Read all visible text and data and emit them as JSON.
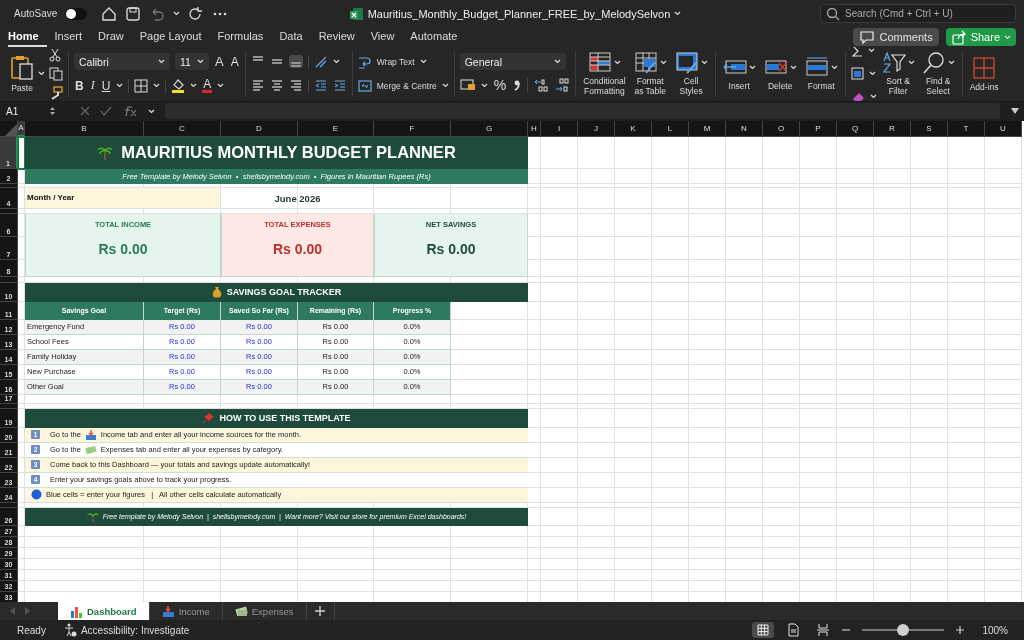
{
  "title_bar": {
    "autosave": {
      "label": "AutoSave",
      "on": false
    },
    "document_title": "Mauritius_Monthly_Budget_Planner_FREE_by_MelodySelvon",
    "search": {
      "placeholder": "Search (Cmd + Ctrl + U)"
    }
  },
  "ribbon_tabs": [
    {
      "label": "Home",
      "selected": true
    },
    {
      "label": "Insert",
      "selected": false
    },
    {
      "label": "Draw",
      "selected": false
    },
    {
      "label": "Page Layout",
      "selected": false
    },
    {
      "label": "Formulas",
      "selected": false
    },
    {
      "label": "Data",
      "selected": false
    },
    {
      "label": "Review",
      "selected": false
    },
    {
      "label": "View",
      "selected": false
    },
    {
      "label": "Automate",
      "selected": false
    }
  ],
  "header_buttons": {
    "comments": "Comments",
    "share": "Share"
  },
  "ribbon": {
    "paste": "Paste",
    "font": "Calibri",
    "font_size": "11",
    "grow_font": "A",
    "shrink_font": "A",
    "style_buttons": [
      "B",
      "I",
      "U"
    ],
    "font_color": "A",
    "wrap_text": "Wrap Text",
    "merge": "Merge & Centre",
    "number_format": "General",
    "percent": "%",
    "large_buttons": [
      {
        "label": [
          "Conditional",
          "Formatting"
        ]
      },
      {
        "label": [
          "Format",
          "as Table"
        ]
      },
      {
        "label": [
          "Cell",
          "Styles"
        ]
      },
      {
        "label": [
          "Insert"
        ]
      },
      {
        "label": [
          "Delete"
        ]
      },
      {
        "label": [
          "Format"
        ]
      }
    ],
    "editing_buttons": [
      {
        "label": [
          "Sort &",
          "Filter"
        ]
      },
      {
        "label": [
          "Find &",
          "Select"
        ]
      }
    ],
    "addins": "Add-ins"
  },
  "formula_bar": {
    "name_box": "A1"
  },
  "columns": [
    {
      "label": "A",
      "selected": true
    },
    {
      "label": "B",
      "selected": false
    },
    {
      "label": "C",
      "selected": false
    },
    {
      "label": "D",
      "selected": false
    },
    {
      "label": "E",
      "selected": false
    },
    {
      "label": "F",
      "selected": false
    },
    {
      "label": "G",
      "selected": false
    },
    {
      "label": "H",
      "selected": false
    },
    {
      "label": "I",
      "selected": false
    },
    {
      "label": "J",
      "selected": false
    },
    {
      "label": "K",
      "selected": false
    },
    {
      "label": "L",
      "selected": false
    },
    {
      "label": "M",
      "selected": false
    },
    {
      "label": "N",
      "selected": false
    },
    {
      "label": "O",
      "selected": false
    },
    {
      "label": "P",
      "selected": false
    },
    {
      "label": "Q",
      "selected": false
    },
    {
      "label": "R",
      "selected": false
    },
    {
      "label": "S",
      "selected": false
    },
    {
      "label": "T",
      "selected": false
    },
    {
      "label": "U",
      "selected": false
    }
  ],
  "rows": [
    {
      "kind": "row",
      "number": "1",
      "selected": true
    },
    {
      "kind": "row",
      "number": "2",
      "selected": false
    },
    {
      "kind": "spacer"
    },
    {
      "kind": "row",
      "number": "4",
      "selected": false
    },
    {
      "kind": "spacer"
    },
    {
      "kind": "row",
      "number": "6",
      "selected": false
    },
    {
      "kind": "row",
      "number": "7",
      "selected": false
    },
    {
      "kind": "row",
      "number": "8",
      "selected": false
    },
    {
      "kind": "spacer"
    },
    {
      "kind": "row",
      "number": "10",
      "selected": false
    },
    {
      "kind": "row",
      "number": "11",
      "selected": false
    },
    {
      "kind": "row",
      "number": "12",
      "selected": false
    },
    {
      "kind": "row",
      "number": "13",
      "selected": false
    },
    {
      "kind": "row",
      "number": "14",
      "selected": false
    },
    {
      "kind": "row",
      "number": "15",
      "selected": false
    },
    {
      "kind": "row",
      "number": "16",
      "selected": false
    },
    {
      "kind": "row",
      "number": "17",
      "selected": false
    },
    {
      "kind": "spacer"
    },
    {
      "kind": "row",
      "number": "19",
      "selected": false
    },
    {
      "kind": "row",
      "number": "20",
      "selected": false
    },
    {
      "kind": "row",
      "number": "21",
      "selected": false
    },
    {
      "kind": "row",
      "number": "22",
      "selected": false
    },
    {
      "kind": "row",
      "number": "23",
      "selected": false
    },
    {
      "kind": "row",
      "number": "24",
      "selected": false
    },
    {
      "kind": "spacer"
    },
    {
      "kind": "row",
      "number": "26",
      "selected": false
    },
    {
      "kind": "row",
      "number": "27",
      "selected": false
    },
    {
      "kind": "row",
      "number": "28",
      "selected": false
    },
    {
      "kind": "row",
      "number": "29",
      "selected": false
    },
    {
      "kind": "row",
      "number": "30",
      "selected": false
    },
    {
      "kind": "row",
      "number": "31",
      "selected": false
    },
    {
      "kind": "row",
      "number": "32",
      "selected": false
    },
    {
      "kind": "row",
      "number": "33",
      "selected": false
    }
  ],
  "dashboard": {
    "title": "MAURITIUS MONTHLY BUDGET PLANNER",
    "subtitle": "Free Template by Melody Selvon  •  shellsbymelody.com  •  Figures in Mauritian Rupees (Rs)",
    "month": {
      "label": "Month / Year",
      "value": "June 2026"
    },
    "summary": [
      {
        "kind": "income",
        "label": "TOTAL INCOME",
        "value": "Rs 0.00"
      },
      {
        "kind": "expense",
        "label": "TOTAL EXPENSES",
        "value": "Rs 0.00"
      },
      {
        "kind": "savings",
        "label": "NET SAVINGS",
        "value": "Rs 0.00"
      }
    ],
    "savings_tracker": {
      "title": "SAVINGS GOAL TRACKER",
      "columns": [
        "Savings Goal",
        "Target (Rs)",
        "Saved So Far (Rs)",
        "Remaining (Rs)",
        "Progress %"
      ],
      "rows": [
        {
          "goal": "Emergency Fund",
          "target": "Rs 0.00",
          "saved": "Rs 0.00",
          "remaining": "Rs 0.00",
          "progress": "0.0%"
        },
        {
          "goal": "School Fees",
          "target": "Rs 0.00",
          "saved": "Rs 0.00",
          "remaining": "Rs 0.00",
          "progress": "0.0%"
        },
        {
          "goal": "Family Holiday",
          "target": "Rs 0.00",
          "saved": "Rs 0.00",
          "remaining": "Rs 0.00",
          "progress": "0.0%"
        },
        {
          "goal": "New Purchase",
          "target": "Rs 0.00",
          "saved": "Rs 0.00",
          "remaining": "Rs 0.00",
          "progress": "0.0%"
        },
        {
          "goal": "Other Goal",
          "target": "Rs 0.00",
          "saved": "Rs 0.00",
          "remaining": "Rs 0.00",
          "progress": "0.0%"
        }
      ]
    },
    "how_to": {
      "title": "HOW TO USE THIS TEMPLATE",
      "steps": [
        {
          "kind": "numbered",
          "number": "1",
          "before": "Go to the",
          "after": "Income tab and enter all your income sources for the month."
        },
        {
          "kind": "numbered",
          "number": "2",
          "before": "Go to the",
          "after": "Expenses tab and enter all your expenses by category."
        },
        {
          "kind": "numbered",
          "number": "3",
          "text": "Come back to this Dashboard — your totals and savings update automatically!"
        },
        {
          "kind": "numbered",
          "number": "4",
          "text": "Enter your savings goals above to track your progress."
        },
        {
          "kind": "note",
          "text": "Blue cells = enter your figures   |   All other cells calculate automatically"
        }
      ]
    },
    "footer": "Free template by Melody Selvon  |  shellsbymelody.com  |  Want more? Visit our store for premium Excel dashboards!"
  },
  "sheet_tabs": [
    {
      "label": "Dashboard",
      "selected": true
    },
    {
      "label": "Income",
      "selected": false
    },
    {
      "label": "Expenses",
      "selected": false
    }
  ],
  "status_bar": {
    "status": "Ready",
    "accessibility": "Accessibility: Investigate",
    "views": [
      {
        "selected": true
      },
      {
        "selected": false
      },
      {
        "selected": false
      }
    ],
    "zoom": {
      "level": 0.5,
      "reading": "100%"
    }
  }
}
